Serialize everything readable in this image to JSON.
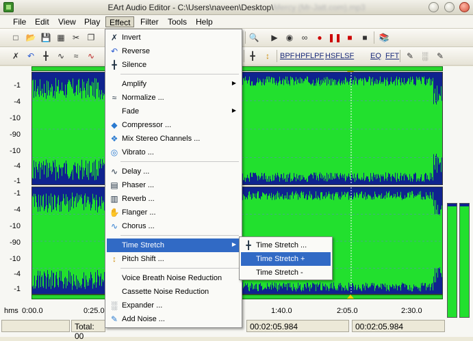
{
  "window": {
    "title": "EArt Audio Editor - C:\\Users\\naveen\\Desktop\\",
    "title_blurred": "Mercy (Mr-Jatt.com).mp3"
  },
  "menubar": {
    "items": [
      "File",
      "Edit",
      "View",
      "Play",
      "Effect",
      "Filter",
      "Tools",
      "Help"
    ]
  },
  "toolbar2": {
    "filter_labels": [
      "BPF",
      "HPF",
      "LPF",
      "HSF",
      "LSF",
      "EQ",
      "FFT"
    ]
  },
  "axis": {
    "top_ticks": [
      "-1",
      "-4",
      "-10",
      "-90",
      "-10",
      "-4",
      "-1"
    ],
    "bottom_ticks": [
      "-1",
      "-4",
      "-10",
      "-90",
      "-10",
      "-4",
      "-1"
    ]
  },
  "timeline": {
    "unit": "hms",
    "labels": [
      "0:00.0",
      "0:25.0",
      "1:40.0",
      "2:05.0",
      "2:30.0"
    ]
  },
  "status": {
    "total_label": "Total: 00",
    "value1": "00:02:05.984",
    "value2": "00:02:05.984"
  },
  "effect_menu": {
    "items": [
      {
        "label": "Invert",
        "icon": "invert-icon"
      },
      {
        "label": "Reverse",
        "icon": "reverse-icon"
      },
      {
        "label": "Silence",
        "icon": "silence-icon"
      },
      {
        "label": "Amplify",
        "icon": "",
        "submenu": true
      },
      {
        "label": "Normalize ...",
        "icon": "normalize-icon"
      },
      {
        "label": "Fade",
        "icon": "",
        "submenu": true
      },
      {
        "label": "Compressor ...",
        "icon": "compressor-icon"
      },
      {
        "label": "Mix Stereo Channels ...",
        "icon": "mix-stereo-icon"
      },
      {
        "label": "Vibrato ...",
        "icon": "vibrato-icon"
      },
      {
        "label": "Delay ...",
        "icon": "delay-icon"
      },
      {
        "label": "Phaser ...",
        "icon": "phaser-icon"
      },
      {
        "label": "Reverb ...",
        "icon": "reverb-icon"
      },
      {
        "label": "Flanger ...",
        "icon": "flanger-icon"
      },
      {
        "label": "Chorus ...",
        "icon": "chorus-icon"
      },
      {
        "label": "Time Stretch",
        "icon": "",
        "submenu": true
      },
      {
        "label": "Pitch Shift ...",
        "icon": "pitch-shift-icon"
      },
      {
        "label": "Voice Breath Noise Reduction",
        "icon": ""
      },
      {
        "label": "Cassette Noise Reduction",
        "icon": ""
      },
      {
        "label": "Expander ...",
        "icon": "expander-icon"
      },
      {
        "label": "Add Noise ...",
        "icon": "add-noise-icon"
      }
    ]
  },
  "time_stretch_menu": {
    "items": [
      {
        "label": "Time Stretch ...",
        "icon": "time-stretch-icon"
      },
      {
        "label": "Time Stretch +",
        "icon": ""
      },
      {
        "label": "Time Stretch -",
        "icon": ""
      }
    ]
  },
  "colors": {
    "waveform": "#22e02e",
    "wave_bg": "#0f238f",
    "menu_highlight": "#316ac5"
  }
}
